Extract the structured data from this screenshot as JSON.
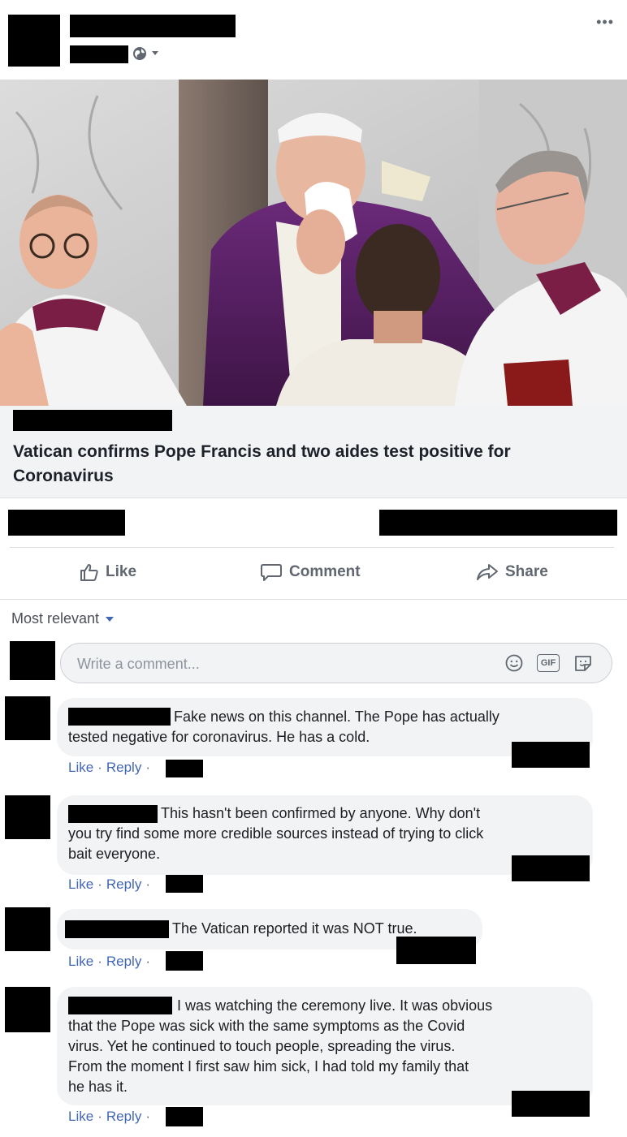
{
  "post": {
    "more_label": "•••",
    "link_title": "Vatican confirms Pope Francis and two aides test positive for Coronavirus"
  },
  "actions": {
    "like": "Like",
    "comment": "Comment",
    "share": "Share"
  },
  "sort": {
    "label": "Most relevant"
  },
  "composer": {
    "placeholder": "Write a comment...",
    "gif_label": "GIF"
  },
  "comment_meta": {
    "like": "Like",
    "reply": "Reply",
    "separator": "·"
  },
  "comments": [
    {
      "text_lines": [
        "Fake news on this channel. The Pope has actually",
        "tested negative for coronavirus. He has a cold."
      ]
    },
    {
      "text_lines": [
        "This hasn't been confirmed by anyone. Why don't",
        "you try find some more credible sources instead of trying to click",
        "bait everyone."
      ]
    },
    {
      "text_lines": [
        "The Vatican reported it was NOT true."
      ]
    },
    {
      "text_lines": [
        "I was watching the ceremony live. It was obvious",
        "that the Pope was sick with the same symptoms as the Covid",
        "virus. Yet he continued to touch people, spreading the virus.",
        "From the moment I first saw him sick, I had told my family that",
        "he has it."
      ]
    }
  ],
  "colors": {
    "link_blue": "#4267b2",
    "action_gray": "#606770",
    "bubble_bg": "#f2f3f5",
    "redaction": "#000000"
  },
  "icons": [
    "globe-icon",
    "thumbs-up-icon",
    "comment-bubble-icon",
    "share-arrow-icon",
    "smiley-icon",
    "gif-icon",
    "sticker-icon",
    "more-icon"
  ]
}
